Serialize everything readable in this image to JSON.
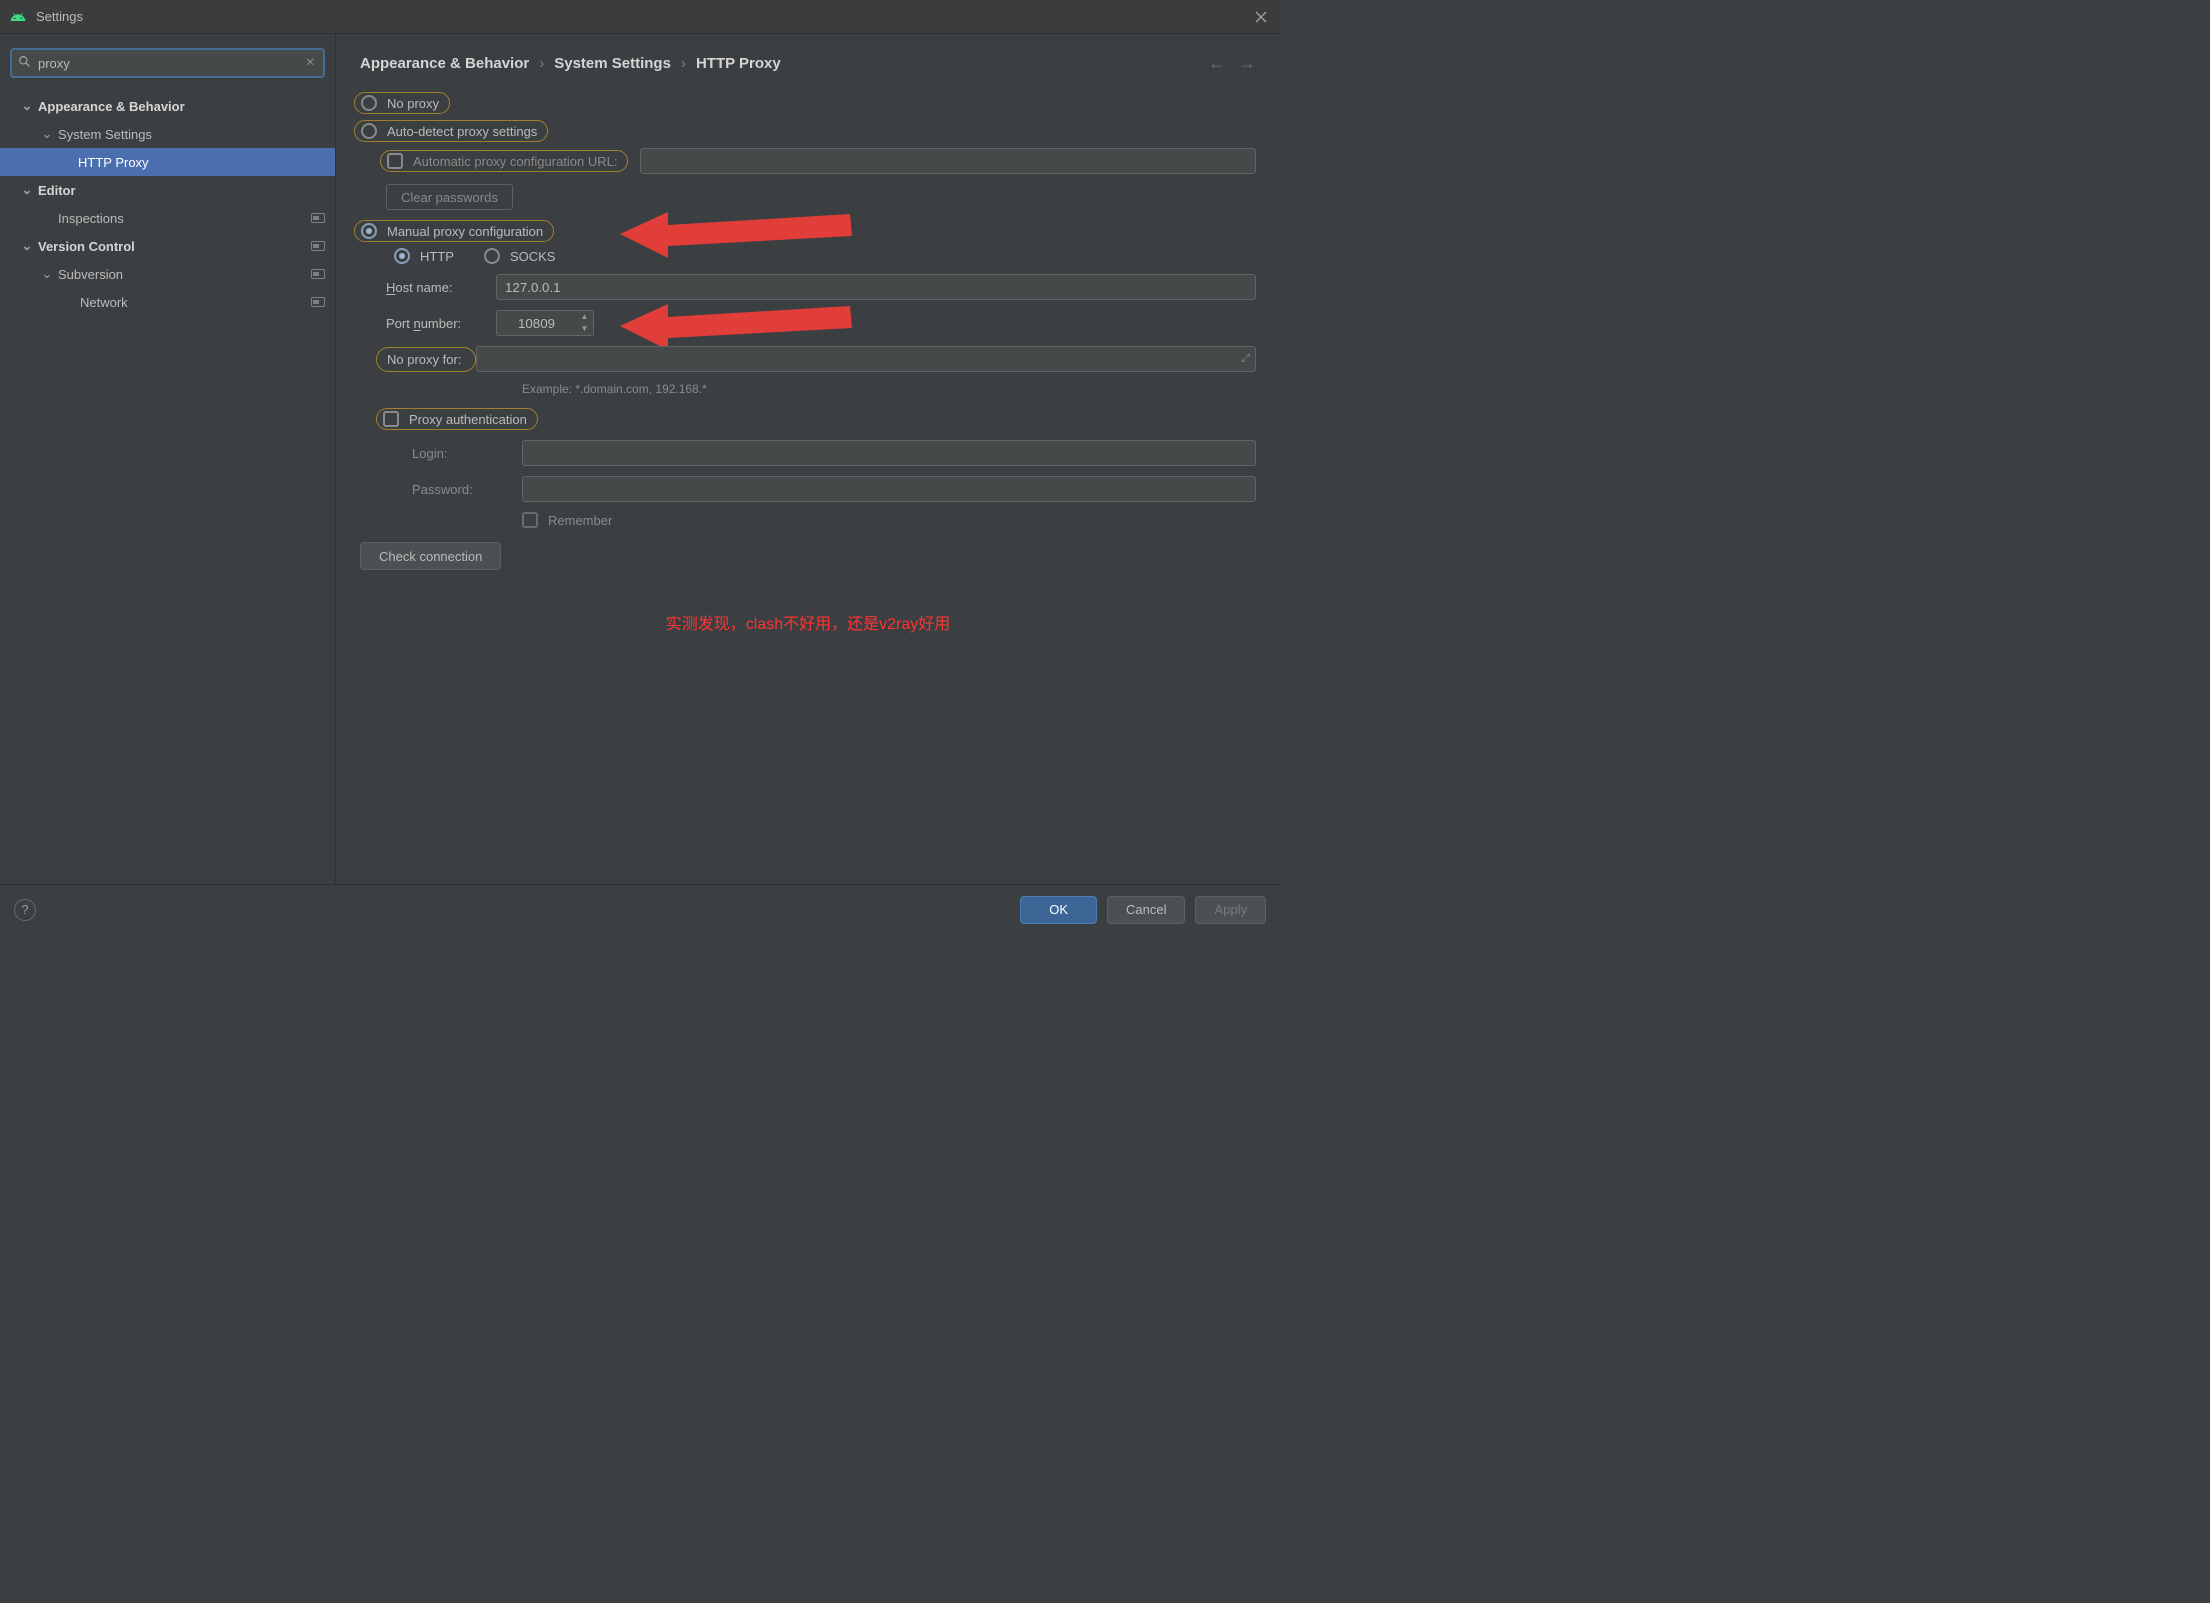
{
  "window": {
    "title": "Settings"
  },
  "search": {
    "value": "proxy"
  },
  "tree": {
    "appearance": "Appearance & Behavior",
    "system_settings": "System Settings",
    "http_proxy": "HTTP Proxy",
    "editor": "Editor",
    "inspections": "Inspections",
    "version_control": "Version Control",
    "subversion": "Subversion",
    "network": "Network"
  },
  "crumbs": {
    "a": "Appearance & Behavior",
    "b": "System Settings",
    "c": "HTTP Proxy"
  },
  "proxy": {
    "no_proxy": "No proxy",
    "auto_detect": "Auto-detect proxy settings",
    "auto_url_label": "Automatic proxy configuration URL:",
    "clear_passwords": "Clear passwords",
    "manual": "Manual proxy configuration",
    "http": "HTTP",
    "socks": "SOCKS",
    "host_label": "Host name:",
    "host_value": "127.0.0.1",
    "port_label": "Port number:",
    "port_value": "10809",
    "no_proxy_for_label": "No proxy for:",
    "no_proxy_for_value": "",
    "example": "Example: *.domain.com, 192.168.*",
    "auth_label": "Proxy authentication",
    "login_label": "Login:",
    "password_label": "Password:",
    "remember": "Remember",
    "check": "Check connection"
  },
  "note": "实测发现，clash不好用，还是v2ray好用",
  "footer": {
    "ok": "OK",
    "cancel": "Cancel",
    "apply": "Apply"
  }
}
